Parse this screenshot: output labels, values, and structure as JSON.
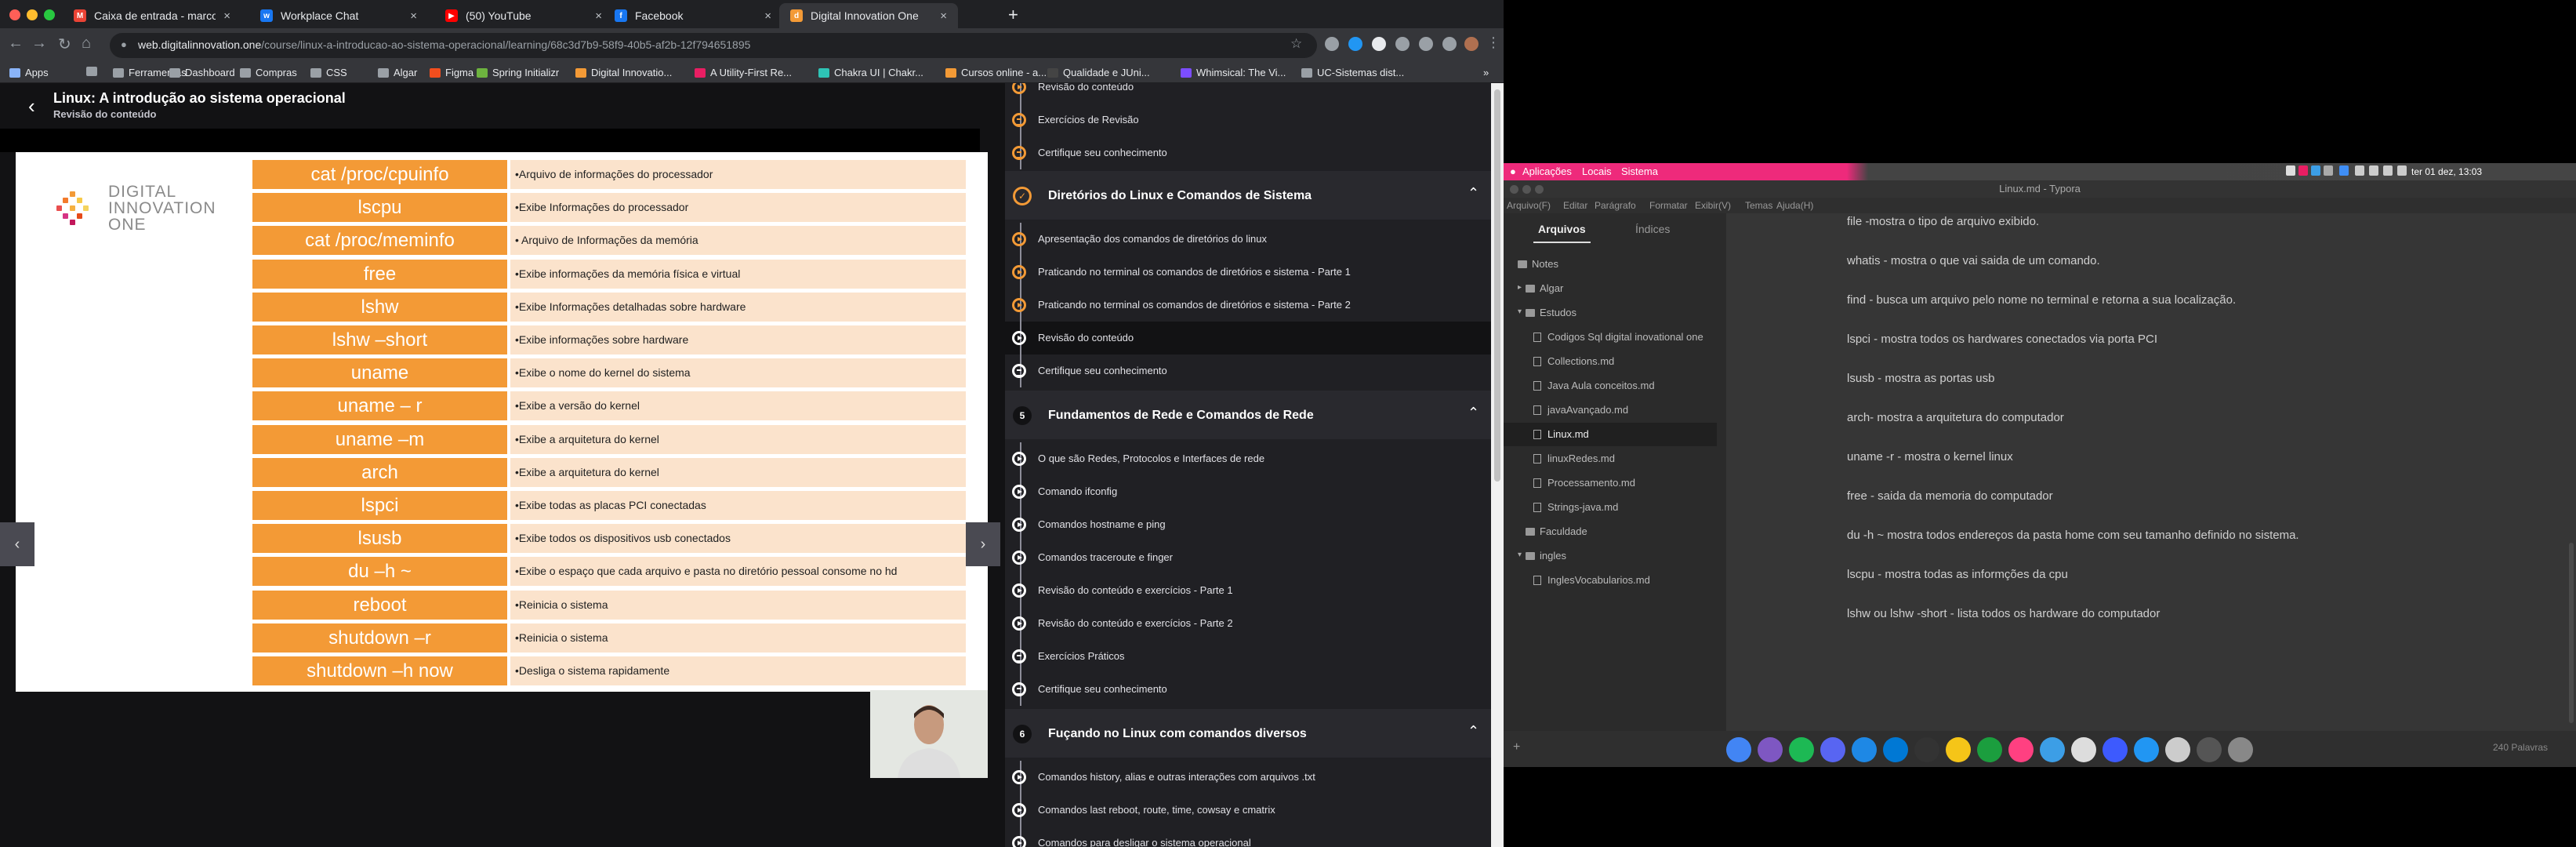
{
  "browser": {
    "tabs": [
      {
        "title": "Caixa de entrada - marcosvo",
        "color": "#ea4335",
        "glyph": "M",
        "active": false
      },
      {
        "title": "Workplace Chat",
        "color": "#1877f2",
        "glyph": "w",
        "active": false
      },
      {
        "title": "(50) YouTube",
        "color": "#ff0000",
        "glyph": "▶",
        "active": false
      },
      {
        "title": "Facebook",
        "color": "#1877f2",
        "glyph": "f",
        "active": false
      },
      {
        "title": "Digital Innovation One",
        "color": "#f39a36",
        "glyph": "d",
        "active": true
      }
    ],
    "url_host": "web.digitalinnovation.one",
    "url_path": "/course/linux-a-introducao-ao-sistema-operacional/learning/68c3d7b9-58f9-40b5-af2b-12f794651895",
    "bookmarks": [
      {
        "label": "Apps",
        "color": "#8ab4f8"
      },
      {
        "label": "",
        "color": "#9aa0a6"
      },
      {
        "label": "Ferramentas",
        "color": "#9aa0a6"
      },
      {
        "label": "Dashboard",
        "color": "#9aa0a6"
      },
      {
        "label": "Compras",
        "color": "#9aa0a6"
      },
      {
        "label": "CSS",
        "color": "#9aa0a6"
      },
      {
        "label": "Algar",
        "color": "#9aa0a6"
      },
      {
        "label": "Figma",
        "color": "#f24e1e"
      },
      {
        "label": "Spring Initializr",
        "color": "#6db33f"
      },
      {
        "label": "Digital Innovatio...",
        "color": "#f39a36"
      },
      {
        "label": "A Utility-First Re...",
        "color": "#e91e63"
      },
      {
        "label": "Chakra UI | Chakr...",
        "color": "#2ec4b6"
      },
      {
        "label": "Cursos online - a...",
        "color": "#f39a36"
      },
      {
        "label": "Qualidade e JUni...",
        "color": "#444"
      },
      {
        "label": "Whimsical: The Vi...",
        "color": "#7c4dff"
      },
      {
        "label": "UC-Sistemas dist...",
        "color": "#9aa0a6"
      }
    ]
  },
  "player": {
    "title": "Linux: A introdução ao sistema operacional",
    "subtitle": "Revisão do conteúdo",
    "logo_line1": "DIGITAL",
    "logo_line2": "INNOVATION",
    "logo_line3": "ONE",
    "rows": [
      {
        "cmd": "cat /proc/cpuinfo",
        "desc": "•Arquivo de informações do processador"
      },
      {
        "cmd": "lscpu",
        "desc": "•Exibe Informações do processador"
      },
      {
        "cmd": "cat /proc/meminfo",
        "desc": "• Arquivo de Informações da memória"
      },
      {
        "cmd": "free",
        "desc": "•Exibe informações da memória física e virtual"
      },
      {
        "cmd": "lshw",
        "desc": "•Exibe Informações detalhadas sobre hardware"
      },
      {
        "cmd": "lshw –short",
        "desc": "•Exibe informações sobre hardware"
      },
      {
        "cmd": "uname",
        "desc": "•Exibe o nome do kernel do sistema"
      },
      {
        "cmd": "uname – r",
        "desc": "•Exibe a versão do kernel"
      },
      {
        "cmd": "uname –m",
        "desc": "•Exibe a arquitetura do kernel"
      },
      {
        "cmd": "arch",
        "desc": "•Exibe a arquitetura do kernel"
      },
      {
        "cmd": "lspci",
        "desc": "•Exibe todas as placas PCI conectadas"
      },
      {
        "cmd": "lsusb",
        "desc": "•Exibe todos os dispositivos usb conectados"
      },
      {
        "cmd": "du –h ~",
        "desc": "•Exibe o espaço que cada arquivo e pasta no diretório pessoal consome no hd"
      },
      {
        "cmd": "reboot",
        "desc": "•Reinicia o sistema"
      },
      {
        "cmd": "shutdown –r",
        "desc": "•Reinicia o sistema"
      },
      {
        "cmd": "shutdown –h now",
        "desc": "•Desliga o sistema rapidamente"
      }
    ]
  },
  "course": {
    "top_items": [
      {
        "label": "Revisão do conteúdo",
        "icon": "play",
        "done": true
      },
      {
        "label": "Exercícios de Revisão",
        "icon": "doc",
        "done": true
      },
      {
        "label": "Certifique seu conhecimento",
        "icon": "doc",
        "done": true
      }
    ],
    "modules": [
      {
        "num": "",
        "title": "Diretórios do Linux e Comandos de Sistema",
        "done": true,
        "items": [
          {
            "label": "Apresentação dos comandos de diretórios do linux",
            "icon": "play",
            "done": true,
            "sel": false
          },
          {
            "label": "Praticando no terminal os comandos de diretórios e sistema - Parte 1",
            "icon": "play",
            "done": true,
            "sel": false
          },
          {
            "label": "Praticando no terminal os comandos de diretórios e sistema - Parte 2",
            "icon": "play",
            "done": true,
            "sel": false
          },
          {
            "label": "Revisão do conteúdo",
            "icon": "play",
            "done": false,
            "sel": true
          },
          {
            "label": "Certifique seu conhecimento",
            "icon": "doc",
            "done": false,
            "sel": false
          }
        ]
      },
      {
        "num": "5",
        "title": "Fundamentos de Rede e Comandos de Rede",
        "done": false,
        "items": [
          {
            "label": "O que são Redes, Protocolos e Interfaces de rede",
            "icon": "play",
            "done": false,
            "sel": false
          },
          {
            "label": "Comando ifconfig",
            "icon": "play",
            "done": false,
            "sel": false
          },
          {
            "label": "Comandos hostname e ping",
            "icon": "play",
            "done": false,
            "sel": false
          },
          {
            "label": "Comandos traceroute e finger",
            "icon": "play",
            "done": false,
            "sel": false
          },
          {
            "label": "Revisão do conteúdo e exercícios - Parte 1",
            "icon": "play",
            "done": false,
            "sel": false
          },
          {
            "label": "Revisão do conteúdo e exercícios - Parte 2",
            "icon": "play",
            "done": false,
            "sel": false
          },
          {
            "label": "Exercícios Práticos",
            "icon": "doc",
            "done": false,
            "sel": false
          },
          {
            "label": "Certifique seu conhecimento",
            "icon": "doc",
            "done": false,
            "sel": false
          }
        ]
      },
      {
        "num": "6",
        "title": "Fuçando no Linux com comandos diversos",
        "done": false,
        "items": [
          {
            "label": "Comandos history, alias e outras interações com arquivos .txt",
            "icon": "play",
            "done": false,
            "sel": false
          },
          {
            "label": "Comandos last reboot, route, time, cowsay e cmatrix",
            "icon": "play",
            "done": false,
            "sel": false
          },
          {
            "label": "Comandos para desligar o sistema operacional",
            "icon": "play",
            "done": false,
            "sel": false
          }
        ]
      }
    ]
  },
  "topbar": {
    "apps": "Aplicações",
    "places": "Locais",
    "system": "Sistema",
    "clock": "ter 01 dez, 13:03"
  },
  "typora": {
    "title": "Linux.md - Typora",
    "menu": [
      "Arquivo(F)",
      "Editar",
      "Parágrafo",
      "Formatar",
      "Exibir(V)",
      "Temas",
      "Ajuda(H)"
    ],
    "tab_files": "Arquivos",
    "tab_index": "Índices",
    "tree": [
      {
        "label": "Notes",
        "type": "folder",
        "level": 0,
        "arrow": "",
        "sel": false
      },
      {
        "label": "Algar",
        "type": "folder",
        "level": 1,
        "arrow": "▸",
        "sel": false
      },
      {
        "label": "Estudos",
        "type": "folder",
        "level": 1,
        "arrow": "▾",
        "sel": false
      },
      {
        "label": "Codigos Sql digital inovational one",
        "type": "file",
        "level": 2,
        "arrow": "",
        "sel": false
      },
      {
        "label": "Collections.md",
        "type": "file",
        "level": 2,
        "arrow": "",
        "sel": false
      },
      {
        "label": "Java Aula conceitos.md",
        "type": "file",
        "level": 2,
        "arrow": "",
        "sel": false
      },
      {
        "label": "javaAvançado.md",
        "type": "file",
        "level": 2,
        "arrow": "",
        "sel": false
      },
      {
        "label": "Linux.md",
        "type": "file",
        "level": 2,
        "arrow": "",
        "sel": true
      },
      {
        "label": "linuxRedes.md",
        "type": "file",
        "level": 2,
        "arrow": "",
        "sel": false
      },
      {
        "label": "Processamento.md",
        "type": "file",
        "level": 2,
        "arrow": "",
        "sel": false
      },
      {
        "label": "Strings-java.md",
        "type": "file",
        "level": 2,
        "arrow": "",
        "sel": false
      },
      {
        "label": "Faculdade",
        "type": "folder",
        "level": 1,
        "arrow": "",
        "sel": false
      },
      {
        "label": "ingles",
        "type": "folder",
        "level": 1,
        "arrow": "▾",
        "sel": false
      },
      {
        "label": "InglesVocabularios.md",
        "type": "file",
        "level": 2,
        "arrow": "",
        "sel": false
      }
    ],
    "lines": [
      "file -mostra o tipo de arquivo exibido.",
      "whatis - mostra o que vai saida de um comando.",
      "find - busca um arquivo pelo nome no terminal e retorna a sua localização.",
      "lspci - mostra todos os hardwares conectados via porta PCI",
      "lsusb - mostra as portas usb",
      "arch- mostra a arquitetura do computador",
      "uname -r - mostra o kernel linux",
      "free - saida da memoria do computador",
      "du -h ~ mostra todos endereços da pasta home com seu tamanho definido no sistema.",
      "lscpu - mostra todas as informções da cpu",
      "lshw ou lshw -short - lista todos os hardware do computador"
    ],
    "word_count": "240 Palavras",
    "plus": "+"
  },
  "dock_colors": [
    "#4285f4",
    "#7e57c2",
    "#1db954",
    "#5865f2",
    "#1e88e5",
    "#0078d4",
    "#333",
    "#f5c518",
    "#1b9e3e",
    "#ff4081",
    "#3c9ee6",
    "#ddd",
    "#3d5afe",
    "#2196f3",
    "#cccccc",
    "#555",
    "#888"
  ],
  "glyphs": {
    "back": "‹",
    "next": "›",
    "chev_up": "⌃",
    "menu_back": "←",
    "menu_fwd": "→",
    "reload": "↻",
    "home": "⌂",
    "star": "☆",
    "more": "⋮",
    "lock": "🔒",
    "bookmark_more": "»"
  }
}
